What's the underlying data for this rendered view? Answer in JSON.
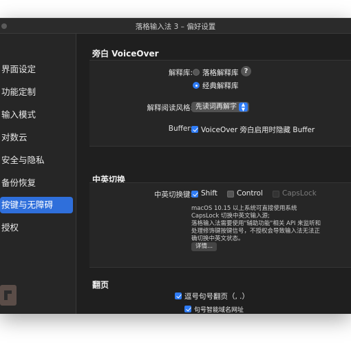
{
  "window": {
    "title": "落格输入法 3 – 偏好设置"
  },
  "sidebar": {
    "items": [
      {
        "label": "界面设定",
        "active": false
      },
      {
        "label": "功能定制",
        "active": false
      },
      {
        "label": "输入模式",
        "active": false
      },
      {
        "label": "对数云",
        "active": false
      },
      {
        "label": "安全与隐私",
        "active": false
      },
      {
        "label": "备份恢复",
        "active": false
      },
      {
        "label": "按键与无障碍",
        "active": true
      },
      {
        "label": "授权",
        "active": false
      }
    ],
    "logo_icon": "app-logo-icon"
  },
  "voiceover": {
    "heading": "旁白 VoiceOver",
    "library_label": "解释库:",
    "library_options": [
      {
        "label": "落格解释库",
        "selected": false
      },
      {
        "label": "经典解释库",
        "selected": true
      }
    ],
    "help_label": "?",
    "style_label": "解释阅读风格:",
    "style_value": "先读词再解字",
    "buffer_label": "Buffer:",
    "buffer_option": {
      "label": "VoiceOver 旁白启用时隐藏 Buffer",
      "checked": true
    }
  },
  "switch": {
    "heading": "中英切换",
    "key_label": "中英切换键:",
    "keys": [
      {
        "label": "Shift",
        "checked": true,
        "enabled": true
      },
      {
        "label": "Control",
        "checked": false,
        "enabled": true
      },
      {
        "label": "CapsLock",
        "checked": false,
        "enabled": false
      }
    ],
    "description": "macOS 10.15 以上系统可直接使用系统 CapsLock 切换中英文输入源;\n落格输入法需要使用\"辅助功能\"相关 API 来监听和处理修饰键按键信号，不授权会导致输入法无法正确切换中英文状态。",
    "details_button": "详情..."
  },
  "paging": {
    "heading": "翻页",
    "options": [
      {
        "label": "逗号句号翻页（, .）",
        "checked": true
      },
      {
        "label": "句号智能域名网址",
        "checked": true
      }
    ]
  },
  "colors": {
    "accent": "#2f7cf6",
    "sidebar_selected": "#2f6fdb",
    "background": "#1f1f1f"
  }
}
